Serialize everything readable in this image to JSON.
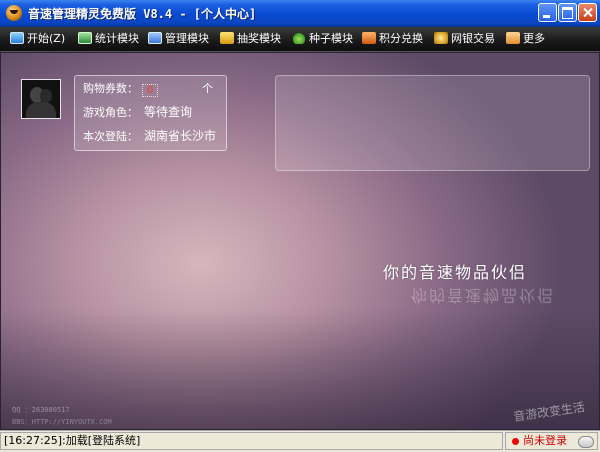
{
  "window": {
    "title": "音速管理精灵免费版 V8.4 - [个人中心]"
  },
  "menu": {
    "items": [
      {
        "label": "开始(Z)",
        "icon": "monitor-icon"
      },
      {
        "label": "统计模块",
        "icon": "chart-icon"
      },
      {
        "label": "管理模块",
        "icon": "manage-icon"
      },
      {
        "label": "抽奖模块",
        "icon": "lottery-icon"
      },
      {
        "label": "种子模块",
        "icon": "seed-icon"
      },
      {
        "label": "积分兑换",
        "icon": "points-icon"
      },
      {
        "label": "网银交易",
        "icon": "silver-icon"
      },
      {
        "label": "更多",
        "icon": "more-icon"
      }
    ]
  },
  "profile": {
    "coupons_label": "购物券数：",
    "coupons_value": "0",
    "collapse": "个",
    "role_label": "游戏角色：",
    "role_value": "等待查询",
    "login_label": "本次登陆：",
    "login_value": "湖南省长沙市"
  },
  "banner": {
    "slogan_line": "你的音速物品伙侣",
    "qq": "QQ ：263080517",
    "url": "BBS：HTTP://YINYOUTX.COM",
    "corner": "音游改变生活"
  },
  "status": {
    "message": "[16:27:25]:加载[登陆系统]",
    "login_state": "尚未登录"
  },
  "colors": {
    "titlebar": "#0a4ad2",
    "menubar": "#191919",
    "status_error": "#cc0000"
  }
}
